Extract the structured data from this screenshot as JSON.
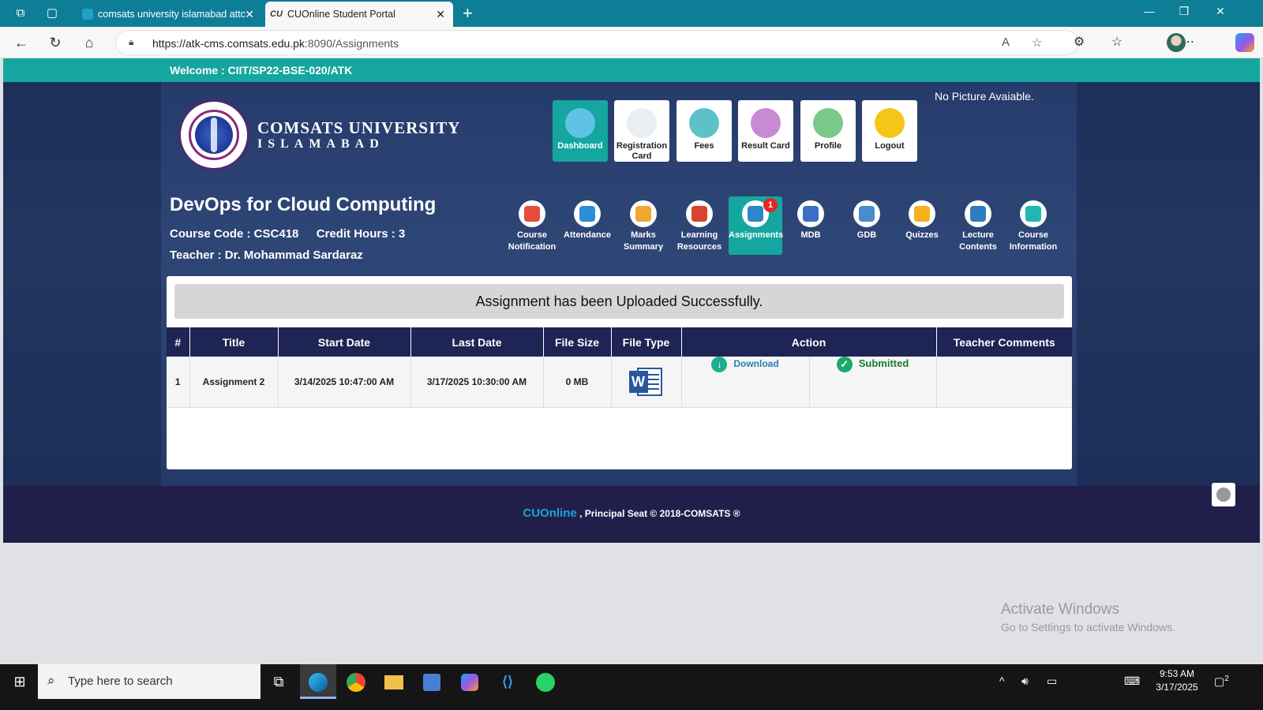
{
  "browser": {
    "tabs": [
      {
        "title": "comsats university islamabad attc",
        "active": false
      },
      {
        "title": "CUOnline Student Portal",
        "active": true
      }
    ],
    "active_tab_favicon": "CU",
    "url_host": "https://atk-cms.comsats.edu.pk",
    "url_path": ":8090/Assignments"
  },
  "portal": {
    "welcome": "Welcome : CIIT/SP22-BSE-020/ATK",
    "university_name": "COMSATS UNIVERSITY",
    "university_city": "ISLAMABAD",
    "no_picture": "No Picture Avaiable.",
    "top_nav": [
      {
        "label": "Dashboard",
        "icon": "home-icon",
        "color": "#f47c3c"
      },
      {
        "label": "Registration Card",
        "icon": "registration-icon",
        "color": "#2bb39b"
      },
      {
        "label": "Fees",
        "icon": "fees-icon",
        "color": "#6cc24a"
      },
      {
        "label": "Result Card",
        "icon": "result-card-icon",
        "color": "#b565b8"
      },
      {
        "label": "Profile",
        "icon": "profile-icon",
        "color": "#4aa861"
      },
      {
        "label": "Logout",
        "icon": "logout-icon",
        "color": "#f2b619"
      }
    ],
    "course": {
      "title": "DevOps for Cloud Computing",
      "code_label": "Course Code : CSC418",
      "credit_label": "Credit Hours : 3",
      "teacher_label": "Teacher : Dr. Mohammad Sardaraz"
    },
    "course_nav": [
      {
        "label": "Course Notification",
        "icon": "megaphone-icon",
        "color": "#e74c3c"
      },
      {
        "label": "Attendance",
        "icon": "attendance-icon",
        "color": "#2a8fd6"
      },
      {
        "label": "Marks Summary",
        "icon": "marks-icon",
        "color": "#f0a830"
      },
      {
        "label": "Learning Resources",
        "icon": "resources-icon",
        "color": "#d9432f"
      },
      {
        "label": "Assignments",
        "icon": "assignments-icon",
        "color": "#2c86c9",
        "badge": "1"
      },
      {
        "label": "MDB",
        "icon": "mdb-icon",
        "color": "#3b6fc4"
      },
      {
        "label": "GDB",
        "icon": "gdb-icon",
        "color": "#4b8bd0"
      },
      {
        "label": "Quizzes",
        "icon": "quizzes-icon",
        "color": "#f3b21c"
      },
      {
        "label": "Lecture Contents",
        "icon": "lecture-icon",
        "color": "#2d7cc0"
      },
      {
        "label": "Course Information",
        "icon": "info-icon",
        "color": "#1fb8b1"
      }
    ],
    "alert": "Assignment has been Uploaded Successfully.",
    "table": {
      "headers": [
        "#",
        "Title",
        "Start Date",
        "Last Date",
        "File Size",
        "File Type",
        "Action",
        "Teacher Comments"
      ],
      "rows": [
        {
          "num": "1",
          "title": "Assignment 2",
          "start": "3/14/2025 10:47:00 AM",
          "last": "3/17/2025 10:30:00 AM",
          "size": "0 MB",
          "file_type": "W",
          "download": "Download",
          "status": "Submitted",
          "comments": ""
        }
      ]
    },
    "footer": {
      "brand": "CUOnline",
      "text": " , Principal Seat © 2018-COMSATS ®"
    }
  },
  "windows": {
    "activate_title": "Activate Windows",
    "activate_sub": "Go to Settings to activate Windows.",
    "search_placeholder": "Type here to search",
    "time": "9:53 AM",
    "date": "3/17/2025",
    "notification_count": "2"
  }
}
